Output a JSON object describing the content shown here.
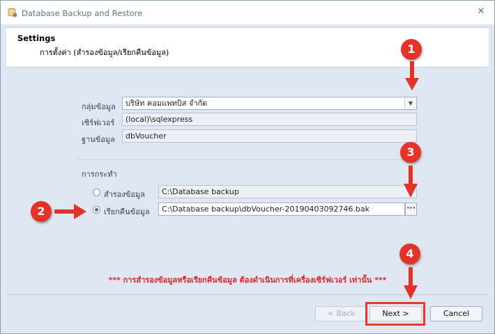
{
  "window": {
    "title": "Database Backup and Restore",
    "close_glyph": "✕"
  },
  "header": {
    "title": "Settings",
    "subtitle": "การตั้งค่า (สำรองข้อมูล/เรียกคืนข้อมูล)"
  },
  "form": {
    "group_label": "กลุ่มข้อมูล",
    "group_value": "บริษัท คอมแพทบิส จำกัด",
    "server_label": "เซิร์ฟเวอร์",
    "server_value": "(local)\\sqlexpress",
    "database_label": "ฐานข้อมูล",
    "database_value": "dbVoucher"
  },
  "action": {
    "section_label": "การกระทำ",
    "backup_label": "สำรองข้อมูล",
    "backup_path": "C:\\Database backup",
    "restore_label": "เรียกคืนข้อมูล",
    "restore_path": "C:\\Database backup\\dbVoucher-20190403092746.bak",
    "selected": "restore",
    "browse_label": "···"
  },
  "warning": "*** การสำรองข้อมูลหรือเรียกคืนข้อมูล ต้องดำเนินการที่เครื่องเซิร์ฟเวอร์ เท่านั้น ***",
  "footer": {
    "back_label": "< Back",
    "next_label": "Next >",
    "cancel_label": "Cancel"
  },
  "annotations": {
    "step1": "1",
    "step2": "2",
    "step3": "3",
    "step4": "4",
    "color": "#e53228"
  }
}
